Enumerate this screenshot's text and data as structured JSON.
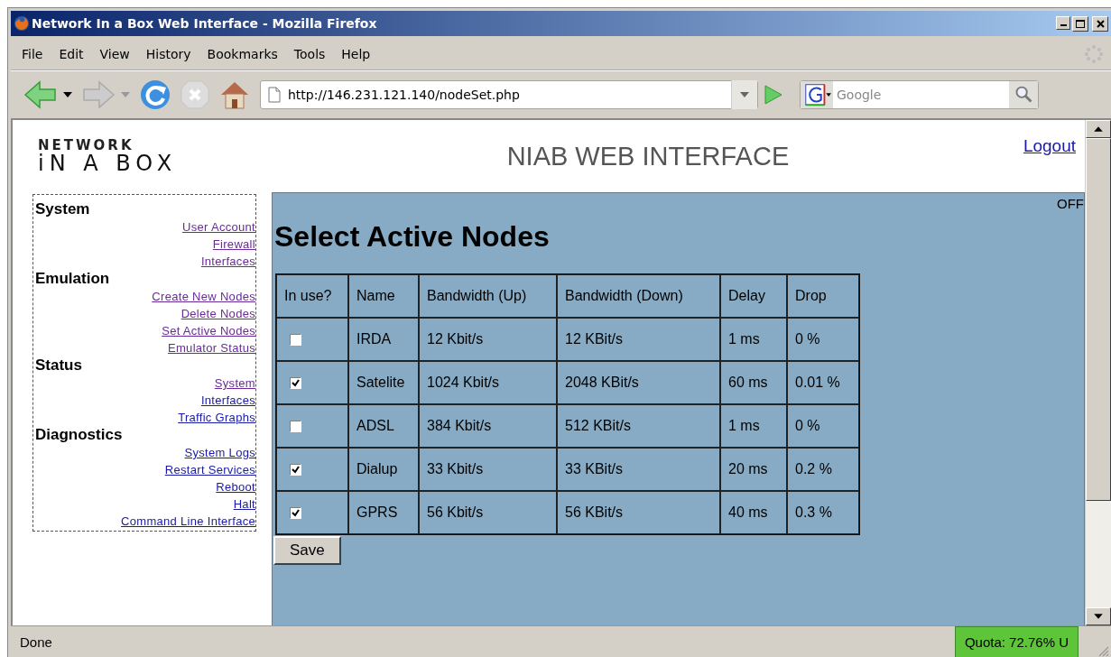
{
  "window": {
    "title": "Network In a Box Web Interface - Mozilla Firefox"
  },
  "menu": [
    "File",
    "Edit",
    "View",
    "History",
    "Bookmarks",
    "Tools",
    "Help"
  ],
  "toolbar": {
    "url": "http://146.231.121.140/nodeSet.php",
    "search_placeholder": "Google"
  },
  "page": {
    "logo": {
      "line_1": "NETWORK",
      "line_2": "iN A BOX"
    },
    "title": "NIAB WEB INTERFACE",
    "logout": "Logout",
    "sidebar": [
      {
        "heading": "System",
        "links": [
          {
            "label": "User Account",
            "visited": true
          },
          {
            "label": "Firewall",
            "visited": true
          },
          {
            "label": "Interfaces",
            "visited": true
          }
        ]
      },
      {
        "heading": "Emulation",
        "links": [
          {
            "label": "Create New Nodes",
            "visited": true
          },
          {
            "label": "Delete Nodes",
            "visited": true
          },
          {
            "label": "Set Active Nodes",
            "visited": true
          },
          {
            "label": "Emulator Status",
            "visited": true
          }
        ]
      },
      {
        "heading": "Status",
        "links": [
          {
            "label": "System",
            "visited": true
          },
          {
            "label": "Interfaces",
            "visited": false
          },
          {
            "label": "Traffic Graphs",
            "visited": false
          }
        ]
      },
      {
        "heading": "Diagnostics",
        "links": [
          {
            "label": "System Logs",
            "visited": false
          },
          {
            "label": "Restart Services",
            "visited": false
          },
          {
            "label": "Reboot",
            "visited": false
          },
          {
            "label": "Halt",
            "visited": false
          },
          {
            "label": "Command Line Interface",
            "visited": false
          }
        ]
      }
    ],
    "panel": {
      "state": "OFF",
      "heading": "Select Active Nodes",
      "table": {
        "columns": [
          "In use?",
          "Name",
          "Bandwidth (Up)",
          "Bandwidth (Down)",
          "Delay",
          "Drop"
        ],
        "rows": [
          {
            "checked": false,
            "name": "IRDA",
            "up": "12 Kbit/s",
            "down": "12 KBit/s",
            "delay": "1 ms",
            "drop": "0 %"
          },
          {
            "checked": true,
            "name": "Satelite",
            "up": "1024 Kbit/s",
            "down": "2048 KBit/s",
            "delay": "60 ms",
            "drop": "0.01 %"
          },
          {
            "checked": false,
            "name": "ADSL",
            "up": "384 Kbit/s",
            "down": "512 KBit/s",
            "delay": "1 ms",
            "drop": "0 %"
          },
          {
            "checked": true,
            "name": "Dialup",
            "up": "33 Kbit/s",
            "down": "33 KBit/s",
            "delay": "20 ms",
            "drop": "0.2 %"
          },
          {
            "checked": true,
            "name": "GPRS",
            "up": "56 Kbit/s",
            "down": "56 KBit/s",
            "delay": "40 ms",
            "drop": "0.3 %"
          }
        ]
      },
      "save": "Save"
    }
  },
  "status_bar": {
    "text": "Done",
    "quota": "Quota: 72.76% U"
  }
}
